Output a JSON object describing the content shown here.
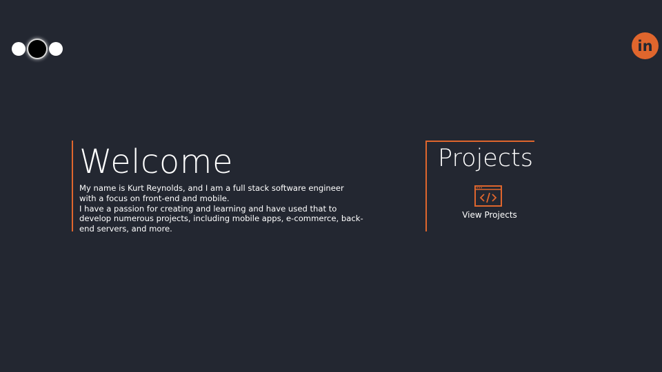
{
  "header": {
    "logo_icon": "three-dots-logo-icon",
    "linkedin_icon": "linkedin-icon",
    "linkedin_text": "in",
    "accent_color": "#e0662d"
  },
  "welcome": {
    "title": "Welcome",
    "bio_line1": "My name is Kurt Reynolds, and I am a full stack software engineer with a focus on front-end and mobile.",
    "bio_line2": "I have a passion for creating and learning and have used that to develop numerous projects, including mobile apps, e-commerce, back-end servers, and more."
  },
  "projects": {
    "title": "Projects",
    "icon": "code-window-icon",
    "link_label": "View Projects"
  },
  "colors": {
    "background": "#232731",
    "accent": "#e0662d",
    "text": "#ffffff"
  }
}
